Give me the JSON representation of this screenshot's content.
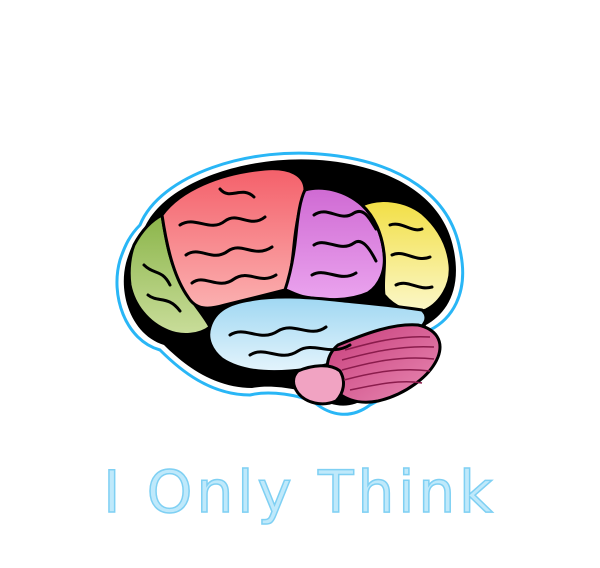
{
  "slogan": {
    "text": "I Only Think",
    "color": "#bfe9fb",
    "stroke_color": "#7fd0f3"
  },
  "brain": {
    "outline_color": "#000000",
    "glow_color": "#29b6f6",
    "regions": [
      {
        "name": "frontal-lobe",
        "color": "#f4747a"
      },
      {
        "name": "parietal-lobe",
        "color": "#d97ad9"
      },
      {
        "name": "occipital-lobe",
        "color": "#f5ec8a"
      },
      {
        "name": "temporal-lobe",
        "color": "#bfe3f5"
      },
      {
        "name": "prefrontal-cortex",
        "color": "#a8c66a"
      },
      {
        "name": "cerebellum",
        "color": "#d84a86"
      },
      {
        "name": "brain-stem",
        "color": "#f1a3c2"
      }
    ]
  }
}
